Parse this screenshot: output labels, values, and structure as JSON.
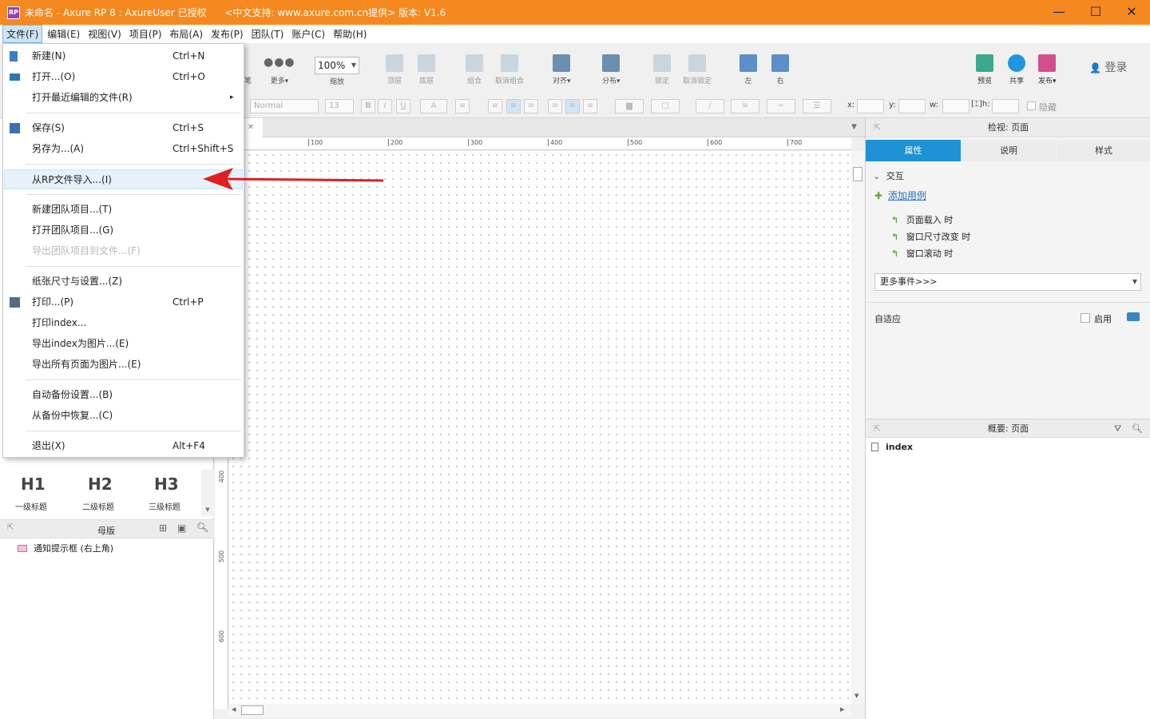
{
  "titlebar": {
    "app_icon_text": "RP",
    "title": "未命名 - Axure RP 8 : AxureUser 已授权      <中文支持: www.axure.com.cn提供> 版本: V1.6",
    "minimize": "—",
    "maximize": "☐",
    "close": "✕"
  },
  "menubar": [
    "文件(F)",
    "编辑(E)",
    "视图(V)",
    "项目(P)",
    "布局(A)",
    "发布(P)",
    "团队(T)",
    "账户(C)",
    "帮助(H)"
  ],
  "toolbar": {
    "partial_left": "笔",
    "more": "更多▾",
    "zoom_value": "100%",
    "zoom_label": "缩放",
    "top_layer": "顶层",
    "bottom_layer": "底层",
    "group": "组合",
    "ungroup": "取消组合",
    "align": "对齐▾",
    "distribute": "分布▾",
    "lock": "锁定",
    "unlock": "取消锁定",
    "left": "左",
    "right": "右",
    "preview": "预览",
    "share": "共享",
    "publish": "发布▾",
    "login": "登录"
  },
  "formatbar": {
    "style_value": "Normal",
    "size_value": "13",
    "bold": "B",
    "italic": "I",
    "underline": "U",
    "font_color": "A",
    "x_label": "x:",
    "y_label": "y:",
    "w_label": "w:",
    "h_label": "h:",
    "hidden_label": "隐藏"
  },
  "file_menu": [
    {
      "label": "新建(N)",
      "shortcut": "Ctrl+N",
      "icon": "new-file-icon"
    },
    {
      "label": "打开...(O)",
      "shortcut": "Ctrl+O",
      "icon": "open-folder-icon"
    },
    {
      "label": "打开最近编辑的文件(R)",
      "shortcut": "",
      "submenu": "▸"
    },
    {
      "label": "保存(S)",
      "shortcut": "Ctrl+S",
      "icon": "save-icon"
    },
    {
      "label": "另存为...(A)",
      "shortcut": "Ctrl+Shift+S"
    },
    {
      "label": "从RP文件导入...(I)",
      "shortcut": "",
      "highlighted": true
    },
    {
      "label": "新建团队项目...(T)",
      "shortcut": ""
    },
    {
      "label": "打开团队项目...(G)",
      "shortcut": ""
    },
    {
      "label": "导出团队项目到文件...(F)",
      "shortcut": "",
      "disabled": true
    },
    {
      "label": "纸张尺寸与设置...(Z)",
      "shortcut": ""
    },
    {
      "label": "打印...(P)",
      "shortcut": "Ctrl+P",
      "icon": "print-icon"
    },
    {
      "label": "打印index...",
      "shortcut": ""
    },
    {
      "label": "导出index为图片...(E)",
      "shortcut": ""
    },
    {
      "label": "导出所有页面为图片...(E)",
      "shortcut": ""
    },
    {
      "label": "自动备份设置...(B)",
      "shortcut": ""
    },
    {
      "label": "从备份中恢复...(C)",
      "shortcut": ""
    },
    {
      "label": "退出(X)",
      "shortcut": "Alt+F4"
    }
  ],
  "widgets": {
    "h1": "H1",
    "h1_label": "一级标题",
    "h2": "H2",
    "h2_label": "二级标题",
    "h3": "H3",
    "h3_label": "三级标题"
  },
  "masters": {
    "title": "母版",
    "items": [
      "通知提示框 (右上角)"
    ]
  },
  "ruler": {
    "h_ticks": [
      "100",
      "200",
      "300",
      "400",
      "500",
      "600",
      "700"
    ],
    "v_ticks": [
      "400",
      "500",
      "600"
    ]
  },
  "inspector": {
    "title": "检视: 页面",
    "tabs": [
      "属性",
      "说明",
      "样式"
    ],
    "section": "交互",
    "add_case": "添加用例",
    "events": [
      "页面载入 时",
      "窗口尺寸改变 时",
      "窗口滚动 时"
    ],
    "more_events": "更多事件>>>",
    "adaptive": "自适应",
    "enable": "启用"
  },
  "outline": {
    "title": "概要: 页面",
    "pages": [
      "index"
    ]
  },
  "colors": {
    "titlebar": "#f5891f",
    "accent": "#1f92d6",
    "arrow": "#e02020",
    "event_icon": "#59a838"
  }
}
